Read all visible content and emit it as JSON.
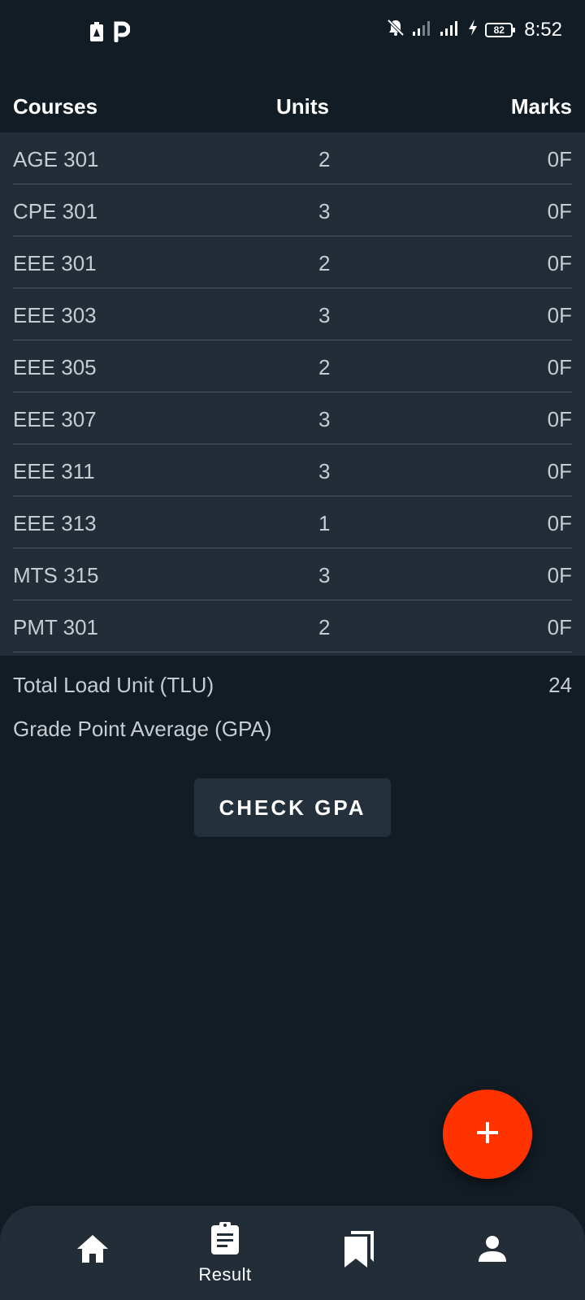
{
  "status_bar": {
    "time": "8:52",
    "battery": "82",
    "left_icons": [
      "alert-battery-icon",
      "parking-p-icon"
    ],
    "right_icons": [
      "bell-off-icon",
      "signal-icon",
      "signal-icon",
      "charging-icon",
      "battery-icon"
    ]
  },
  "table": {
    "headers": {
      "course": "Courses",
      "units": "Units",
      "marks": "Marks"
    },
    "rows": [
      {
        "course": "AGE 301",
        "units": "2",
        "marks": "0F"
      },
      {
        "course": "CPE 301",
        "units": "3",
        "marks": "0F"
      },
      {
        "course": "EEE 301",
        "units": "2",
        "marks": "0F"
      },
      {
        "course": "EEE 303",
        "units": "3",
        "marks": "0F"
      },
      {
        "course": "EEE 305",
        "units": "2",
        "marks": "0F"
      },
      {
        "course": "EEE 307",
        "units": "3",
        "marks": "0F"
      },
      {
        "course": "EEE 311",
        "units": "3",
        "marks": "0F"
      },
      {
        "course": "EEE 313",
        "units": "1",
        "marks": "0F"
      },
      {
        "course": "MTS 315",
        "units": "3",
        "marks": "0F"
      },
      {
        "course": "PMT 301",
        "units": "2",
        "marks": "0F"
      }
    ]
  },
  "summary": {
    "tlu_label": "Total Load Unit (TLU)",
    "tlu_value": "24",
    "gpa_label": "Grade Point Average (GPA)",
    "gpa_value": ""
  },
  "actions": {
    "check_gpa": "CHECK GPA",
    "fab_icon": "plus-icon"
  },
  "bottom_nav": {
    "items": [
      {
        "icon": "home-icon",
        "label": ""
      },
      {
        "icon": "clipboard-icon",
        "label": "Result",
        "active": true
      },
      {
        "icon": "bookmarks-icon",
        "label": ""
      },
      {
        "icon": "person-icon",
        "label": ""
      }
    ]
  },
  "colors": {
    "background": "#121c24",
    "surface": "#222d38",
    "accent": "#ff3300",
    "text_secondary": "#c7ccd1"
  }
}
